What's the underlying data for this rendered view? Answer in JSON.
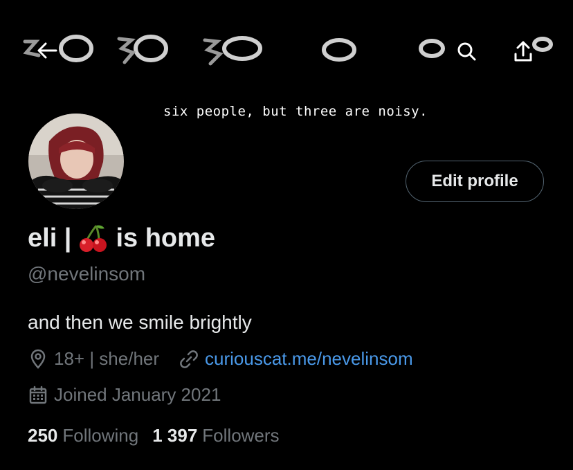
{
  "header": {
    "back_icon": "arrow-left-icon",
    "search_icon": "search-icon",
    "share_icon": "share-icon"
  },
  "banner": {
    "text": "six people, but three are noisy."
  },
  "profile": {
    "display_name_prefix": "eli |",
    "display_name_emoji": "cherries-emoji",
    "display_name_suffix": "is home",
    "handle": "@nevelinsom",
    "bio": "and then we smile brightly",
    "location": "18+ | she/her",
    "website": "curiouscat.me/nevelinsom",
    "joined": "Joined January 2021",
    "edit_label": "Edit profile"
  },
  "stats": {
    "following_count": "250",
    "following_label": "Following",
    "followers_count": "1 397",
    "followers_label": "Followers"
  },
  "colors": {
    "background": "#000000",
    "text_primary": "#e7e9ea",
    "text_secondary": "#71767b",
    "link": "#4a99e9",
    "border": "#536471"
  }
}
